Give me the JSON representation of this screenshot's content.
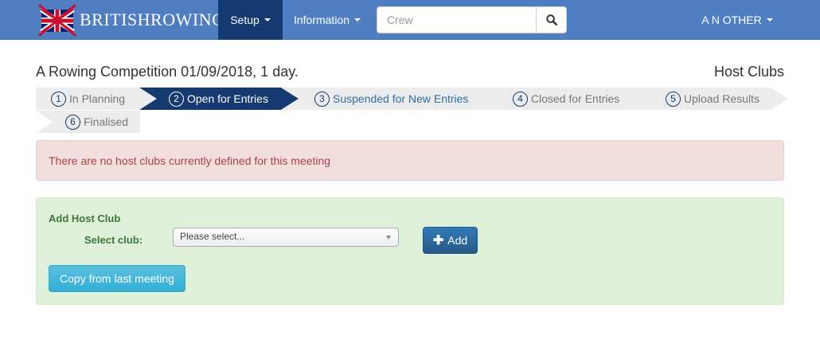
{
  "navbar": {
    "brand": "BRITISHROWING",
    "setup_label": "Setup",
    "information_label": "Information",
    "search_placeholder": "Crew",
    "user_label": "A N OTHER"
  },
  "header": {
    "title": "A Rowing Competition 01/09/2018, 1 day.",
    "section": "Host Clubs"
  },
  "steps": [
    {
      "num": "1",
      "label": "In Planning",
      "state": "done"
    },
    {
      "num": "2",
      "label": "Open for Entries",
      "state": "active"
    },
    {
      "num": "3",
      "label": "Suspended for New Entries",
      "state": "link"
    },
    {
      "num": "4",
      "label": "Closed for Entries",
      "state": "pending"
    },
    {
      "num": "5",
      "label": "Upload Results",
      "state": "pending"
    },
    {
      "num": "6",
      "label": "Finalised",
      "state": "pending"
    }
  ],
  "alert": {
    "message": "There are no host clubs currently defined for this meeting"
  },
  "add_host_club": {
    "title": "Add Host Club",
    "select_label": "Select club:",
    "select_value": "Please select...",
    "add_label": "Add",
    "copy_label": "Copy from last meeting"
  },
  "colors": {
    "navbar": "#4f7ec3",
    "nav_active": "#153a72",
    "step_active": "#153a72",
    "step_inactive": "#ececec",
    "alert_bg": "#f2dede",
    "alert_text": "#a94442",
    "panel_bg": "#dff0d8",
    "panel_text": "#3c763d",
    "primary_button": "#337ab7",
    "info_button": "#5bc0de"
  },
  "icons": {
    "brand": "union-flag-oars-icon",
    "search": "search-icon",
    "add": "plus-icon"
  }
}
